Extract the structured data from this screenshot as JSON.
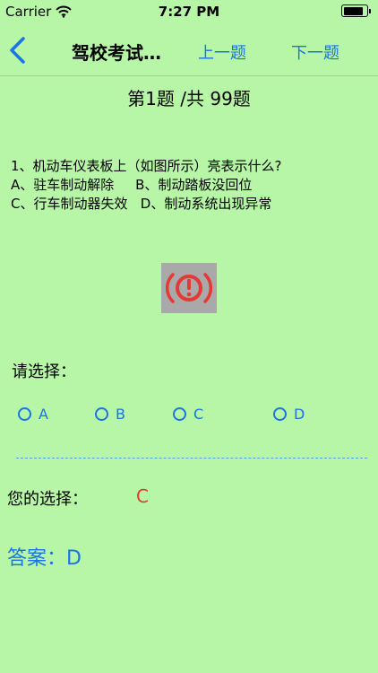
{
  "status_bar": {
    "carrier": "Carrier",
    "time": "7:27 PM"
  },
  "nav": {
    "title": "驾校考试…",
    "prev": "上一题",
    "next": "下一题",
    "back_icon": "chevron-left-icon"
  },
  "counter": "第1题 /共 99题",
  "question": {
    "lines": [
      "1、机动车仪表板上（如图所示）亮表示什么?",
      "A、驻车制动解除     B、制动踏板没回位",
      "C、行车制动器失效   D、制动系统出现异常"
    ],
    "image_icon": "brake-warning-icon",
    "image_color": "#e53935"
  },
  "choose_label": "请选择：",
  "options": [
    "A",
    "B",
    "C",
    "D"
  ],
  "your_choice": {
    "label": "您的选择：",
    "value": "C"
  },
  "answer": "答案：D",
  "colors": {
    "background": "#b6f6a6",
    "accent": "#1a73e8",
    "wrong": "#e53935"
  }
}
